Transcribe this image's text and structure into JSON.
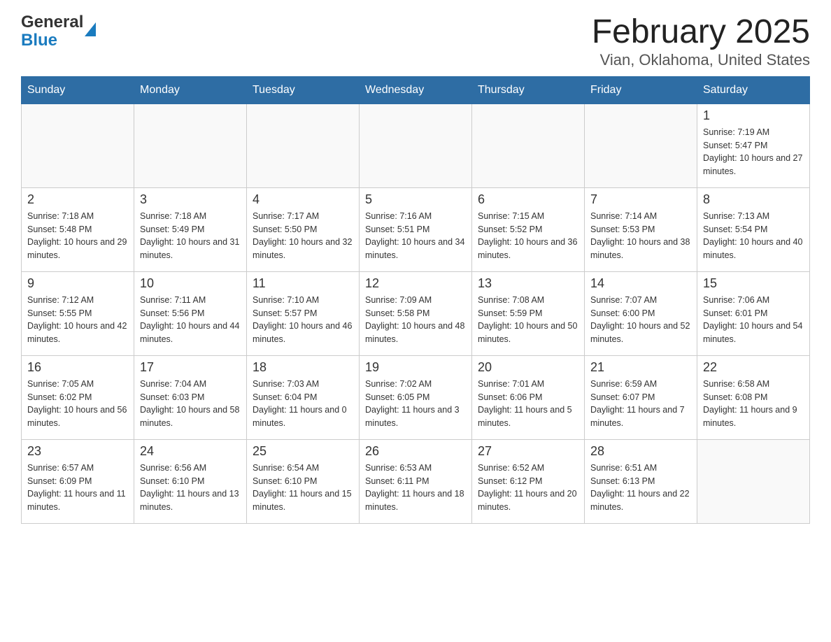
{
  "header": {
    "logo": {
      "general": "General",
      "blue": "Blue",
      "arrow": "▶"
    },
    "title": "February 2025",
    "subtitle": "Vian, Oklahoma, United States"
  },
  "weekdays": [
    "Sunday",
    "Monday",
    "Tuesday",
    "Wednesday",
    "Thursday",
    "Friday",
    "Saturday"
  ],
  "weeks": [
    [
      {
        "day": "",
        "sunrise": "",
        "sunset": "",
        "daylight": ""
      },
      {
        "day": "",
        "sunrise": "",
        "sunset": "",
        "daylight": ""
      },
      {
        "day": "",
        "sunrise": "",
        "sunset": "",
        "daylight": ""
      },
      {
        "day": "",
        "sunrise": "",
        "sunset": "",
        "daylight": ""
      },
      {
        "day": "",
        "sunrise": "",
        "sunset": "",
        "daylight": ""
      },
      {
        "day": "",
        "sunrise": "",
        "sunset": "",
        "daylight": ""
      },
      {
        "day": "1",
        "sunrise": "Sunrise: 7:19 AM",
        "sunset": "Sunset: 5:47 PM",
        "daylight": "Daylight: 10 hours and 27 minutes."
      }
    ],
    [
      {
        "day": "2",
        "sunrise": "Sunrise: 7:18 AM",
        "sunset": "Sunset: 5:48 PM",
        "daylight": "Daylight: 10 hours and 29 minutes."
      },
      {
        "day": "3",
        "sunrise": "Sunrise: 7:18 AM",
        "sunset": "Sunset: 5:49 PM",
        "daylight": "Daylight: 10 hours and 31 minutes."
      },
      {
        "day": "4",
        "sunrise": "Sunrise: 7:17 AM",
        "sunset": "Sunset: 5:50 PM",
        "daylight": "Daylight: 10 hours and 32 minutes."
      },
      {
        "day": "5",
        "sunrise": "Sunrise: 7:16 AM",
        "sunset": "Sunset: 5:51 PM",
        "daylight": "Daylight: 10 hours and 34 minutes."
      },
      {
        "day": "6",
        "sunrise": "Sunrise: 7:15 AM",
        "sunset": "Sunset: 5:52 PM",
        "daylight": "Daylight: 10 hours and 36 minutes."
      },
      {
        "day": "7",
        "sunrise": "Sunrise: 7:14 AM",
        "sunset": "Sunset: 5:53 PM",
        "daylight": "Daylight: 10 hours and 38 minutes."
      },
      {
        "day": "8",
        "sunrise": "Sunrise: 7:13 AM",
        "sunset": "Sunset: 5:54 PM",
        "daylight": "Daylight: 10 hours and 40 minutes."
      }
    ],
    [
      {
        "day": "9",
        "sunrise": "Sunrise: 7:12 AM",
        "sunset": "Sunset: 5:55 PM",
        "daylight": "Daylight: 10 hours and 42 minutes."
      },
      {
        "day": "10",
        "sunrise": "Sunrise: 7:11 AM",
        "sunset": "Sunset: 5:56 PM",
        "daylight": "Daylight: 10 hours and 44 minutes."
      },
      {
        "day": "11",
        "sunrise": "Sunrise: 7:10 AM",
        "sunset": "Sunset: 5:57 PM",
        "daylight": "Daylight: 10 hours and 46 minutes."
      },
      {
        "day": "12",
        "sunrise": "Sunrise: 7:09 AM",
        "sunset": "Sunset: 5:58 PM",
        "daylight": "Daylight: 10 hours and 48 minutes."
      },
      {
        "day": "13",
        "sunrise": "Sunrise: 7:08 AM",
        "sunset": "Sunset: 5:59 PM",
        "daylight": "Daylight: 10 hours and 50 minutes."
      },
      {
        "day": "14",
        "sunrise": "Sunrise: 7:07 AM",
        "sunset": "Sunset: 6:00 PM",
        "daylight": "Daylight: 10 hours and 52 minutes."
      },
      {
        "day": "15",
        "sunrise": "Sunrise: 7:06 AM",
        "sunset": "Sunset: 6:01 PM",
        "daylight": "Daylight: 10 hours and 54 minutes."
      }
    ],
    [
      {
        "day": "16",
        "sunrise": "Sunrise: 7:05 AM",
        "sunset": "Sunset: 6:02 PM",
        "daylight": "Daylight: 10 hours and 56 minutes."
      },
      {
        "day": "17",
        "sunrise": "Sunrise: 7:04 AM",
        "sunset": "Sunset: 6:03 PM",
        "daylight": "Daylight: 10 hours and 58 minutes."
      },
      {
        "day": "18",
        "sunrise": "Sunrise: 7:03 AM",
        "sunset": "Sunset: 6:04 PM",
        "daylight": "Daylight: 11 hours and 0 minutes."
      },
      {
        "day": "19",
        "sunrise": "Sunrise: 7:02 AM",
        "sunset": "Sunset: 6:05 PM",
        "daylight": "Daylight: 11 hours and 3 minutes."
      },
      {
        "day": "20",
        "sunrise": "Sunrise: 7:01 AM",
        "sunset": "Sunset: 6:06 PM",
        "daylight": "Daylight: 11 hours and 5 minutes."
      },
      {
        "day": "21",
        "sunrise": "Sunrise: 6:59 AM",
        "sunset": "Sunset: 6:07 PM",
        "daylight": "Daylight: 11 hours and 7 minutes."
      },
      {
        "day": "22",
        "sunrise": "Sunrise: 6:58 AM",
        "sunset": "Sunset: 6:08 PM",
        "daylight": "Daylight: 11 hours and 9 minutes."
      }
    ],
    [
      {
        "day": "23",
        "sunrise": "Sunrise: 6:57 AM",
        "sunset": "Sunset: 6:09 PM",
        "daylight": "Daylight: 11 hours and 11 minutes."
      },
      {
        "day": "24",
        "sunrise": "Sunrise: 6:56 AM",
        "sunset": "Sunset: 6:10 PM",
        "daylight": "Daylight: 11 hours and 13 minutes."
      },
      {
        "day": "25",
        "sunrise": "Sunrise: 6:54 AM",
        "sunset": "Sunset: 6:10 PM",
        "daylight": "Daylight: 11 hours and 15 minutes."
      },
      {
        "day": "26",
        "sunrise": "Sunrise: 6:53 AM",
        "sunset": "Sunset: 6:11 PM",
        "daylight": "Daylight: 11 hours and 18 minutes."
      },
      {
        "day": "27",
        "sunrise": "Sunrise: 6:52 AM",
        "sunset": "Sunset: 6:12 PM",
        "daylight": "Daylight: 11 hours and 20 minutes."
      },
      {
        "day": "28",
        "sunrise": "Sunrise: 6:51 AM",
        "sunset": "Sunset: 6:13 PM",
        "daylight": "Daylight: 11 hours and 22 minutes."
      },
      {
        "day": "",
        "sunrise": "",
        "sunset": "",
        "daylight": ""
      }
    ]
  ]
}
